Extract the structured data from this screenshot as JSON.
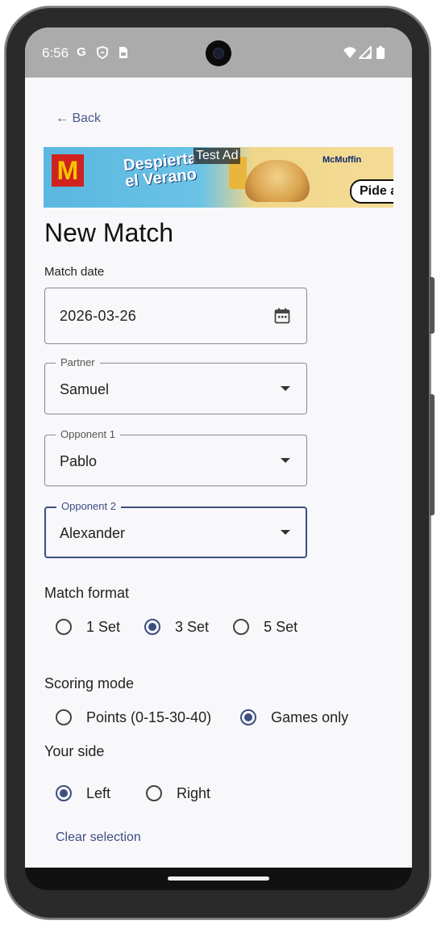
{
  "status_bar": {
    "time": "6:56",
    "left_icons": [
      "google-icon",
      "shield-icon",
      "sim-icon"
    ],
    "right_icons": [
      "wifi-icon",
      "signal-icon",
      "battery-icon"
    ]
  },
  "nav": {
    "back_label": "← Back"
  },
  "ad": {
    "label": "Test Ad",
    "headline": "Despierta el Verano",
    "brand": "McMuffin",
    "cta": "Pide a"
  },
  "page": {
    "title": "New Match"
  },
  "match_date": {
    "label": "Match date",
    "value": "2026-03-26"
  },
  "partner": {
    "label": "Partner",
    "value": "Samuel"
  },
  "opponent1": {
    "label": "Opponent 1",
    "value": "Pablo"
  },
  "opponent2": {
    "label": "Opponent 2",
    "value": "Alexander"
  },
  "match_format": {
    "label": "Match format",
    "options": [
      "1 Set",
      "3 Set",
      "5 Set"
    ],
    "selected": "3 Set"
  },
  "scoring_mode": {
    "label": "Scoring mode",
    "options": [
      "Points (0-15-30-40)",
      "Games only"
    ],
    "selected": "Games only"
  },
  "your_side": {
    "label": "Your side",
    "options": [
      "Left",
      "Right"
    ],
    "selected": "Left",
    "clear_label": "Clear selection"
  },
  "colors": {
    "accent": "#3d4e80",
    "background": "#f8f8fb",
    "status_bar": "#ababab"
  }
}
